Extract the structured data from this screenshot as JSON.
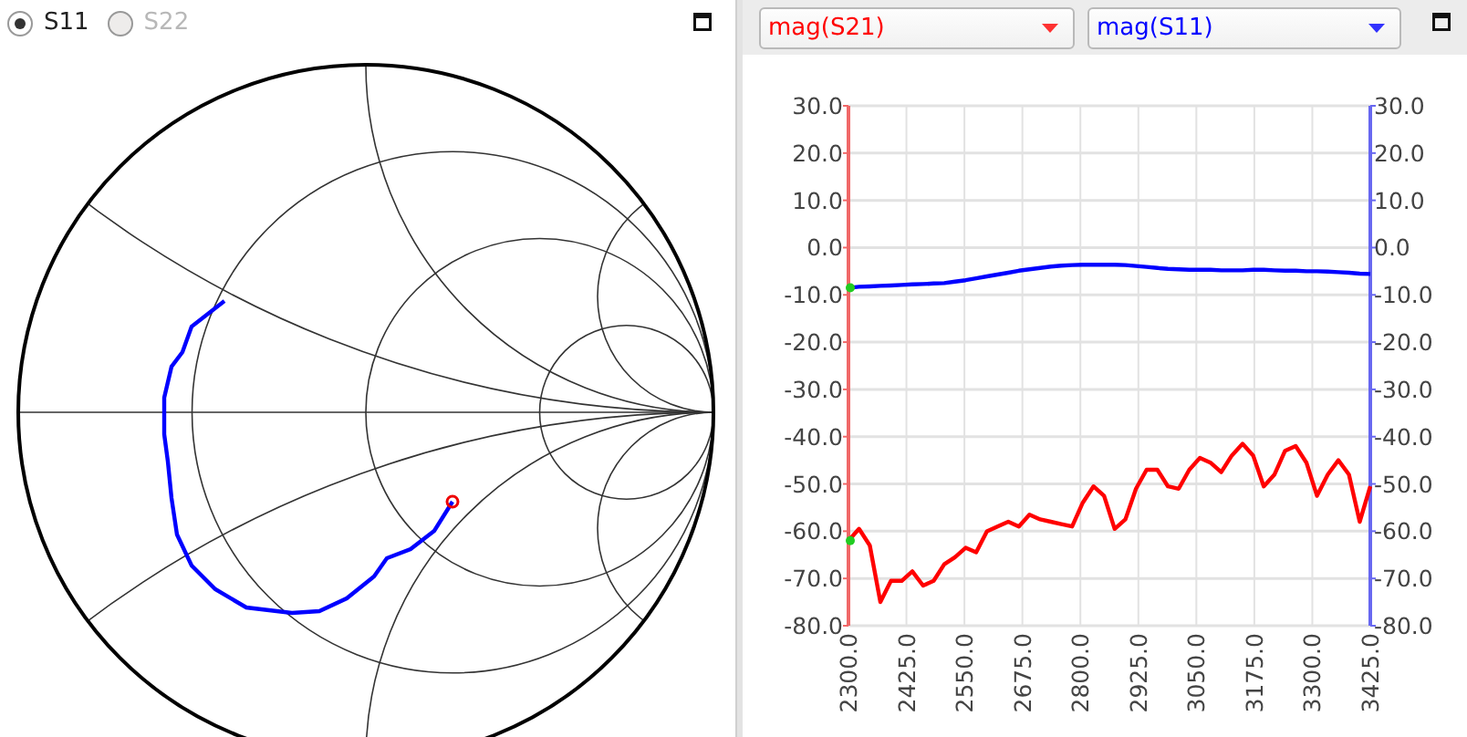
{
  "smith_panel": {
    "ports": [
      {
        "label": "S11",
        "selected": true,
        "disabled": false
      },
      {
        "label": "S22",
        "selected": false,
        "disabled": true
      }
    ]
  },
  "plot_panel": {
    "chart_data": {
      "type": "line",
      "grid": true,
      "x": [
        2300,
        2323,
        2345.9,
        2368.9,
        2391.8,
        2414.8,
        2437.8,
        2460.7,
        2483.7,
        2506.6,
        2529.6,
        2552.6,
        2575.5,
        2598.5,
        2621.4,
        2644.4,
        2667.4,
        2690.3,
        2713.3,
        2736.2,
        2759.2,
        2782.2,
        2805.1,
        2828.1,
        2851,
        2874,
        2897,
        2919.9,
        2942.9,
        2965.8,
        2988.8,
        3011.8,
        3034.7,
        3057.7,
        3080.6,
        3103.6,
        3126.6,
        3149.5,
        3172.5,
        3195.4,
        3218.4,
        3241.4,
        3264.3,
        3287.3,
        3310.2,
        3333.2,
        3356.2,
        3379.1,
        3402.1,
        3425
      ],
      "series": [
        {
          "name": "mag(S21)",
          "color": "#ff0000",
          "values": [
            -62,
            -59.5,
            -63,
            -75,
            -70.5,
            -70.5,
            -68.5,
            -71.5,
            -70.5,
            -67,
            -65.5,
            -63.5,
            -64.5,
            -60,
            -59,
            -58,
            -59,
            -56.5,
            -57.5,
            -58,
            -58.5,
            -59,
            -54,
            -50.5,
            -52.5,
            -59.5,
            -57.5,
            -51,
            -47,
            -47,
            -50.5,
            -51,
            -47,
            -44.5,
            -45.5,
            -47.5,
            -44,
            -41.5,
            -44,
            -50.5,
            -48,
            -43,
            -42,
            -45.5,
            -52.5,
            -48,
            -45,
            -48,
            -58,
            -50.5
          ]
        },
        {
          "name": "mag(S11)",
          "color": "#0000ff",
          "values": [
            -8.5,
            -8.3,
            -8.2,
            -8.1,
            -8,
            -7.9,
            -7.8,
            -7.7,
            -7.6,
            -7.5,
            -7.2,
            -6.9,
            -6.5,
            -6.1,
            -5.7,
            -5.3,
            -4.9,
            -4.6,
            -4.3,
            -4,
            -3.8,
            -3.7,
            -3.6,
            -3.6,
            -3.6,
            -3.6,
            -3.7,
            -3.9,
            -4.1,
            -4.3,
            -4.5,
            -4.6,
            -4.7,
            -4.7,
            -4.7,
            -4.8,
            -4.8,
            -4.8,
            -4.7,
            -4.7,
            -4.8,
            -4.9,
            -4.9,
            -5,
            -5,
            -5.1,
            -5.2,
            -5.3,
            -5.5,
            -5.6
          ]
        }
      ],
      "xlim": [
        2300,
        3425
      ],
      "ylim": [
        -80,
        30
      ],
      "xticks": [
        {
          "value": 2300,
          "label": "2300.0"
        },
        {
          "value": 2425,
          "label": "2425.0"
        },
        {
          "value": 2550,
          "label": "2550.0"
        },
        {
          "value": 2675,
          "label": "2675.0"
        },
        {
          "value": 2800,
          "label": "2800.0"
        },
        {
          "value": 2925,
          "label": "2925.0"
        },
        {
          "value": 3050,
          "label": "3050.0"
        },
        {
          "value": 3175,
          "label": "3175.0"
        },
        {
          "value": 3300,
          "label": "3300.0"
        },
        {
          "value": 3425,
          "label": "3425.0"
        }
      ],
      "yticks": [
        {
          "value": 30,
          "label": "30.0"
        },
        {
          "value": 20,
          "label": "20.0"
        },
        {
          "value": 10,
          "label": "10.0"
        },
        {
          "value": 0,
          "label": "0.0"
        },
        {
          "value": -10,
          "label": "-10.0"
        },
        {
          "value": -20,
          "label": "-20.0"
        },
        {
          "value": -30,
          "label": "-30.0"
        },
        {
          "value": -40,
          "label": "-40.0"
        },
        {
          "value": -50,
          "label": "-50.0"
        },
        {
          "value": -60,
          "label": "-60.0"
        },
        {
          "value": -70,
          "label": "-70.0"
        },
        {
          "value": -80,
          "label": "-80.0"
        }
      ]
    }
  }
}
